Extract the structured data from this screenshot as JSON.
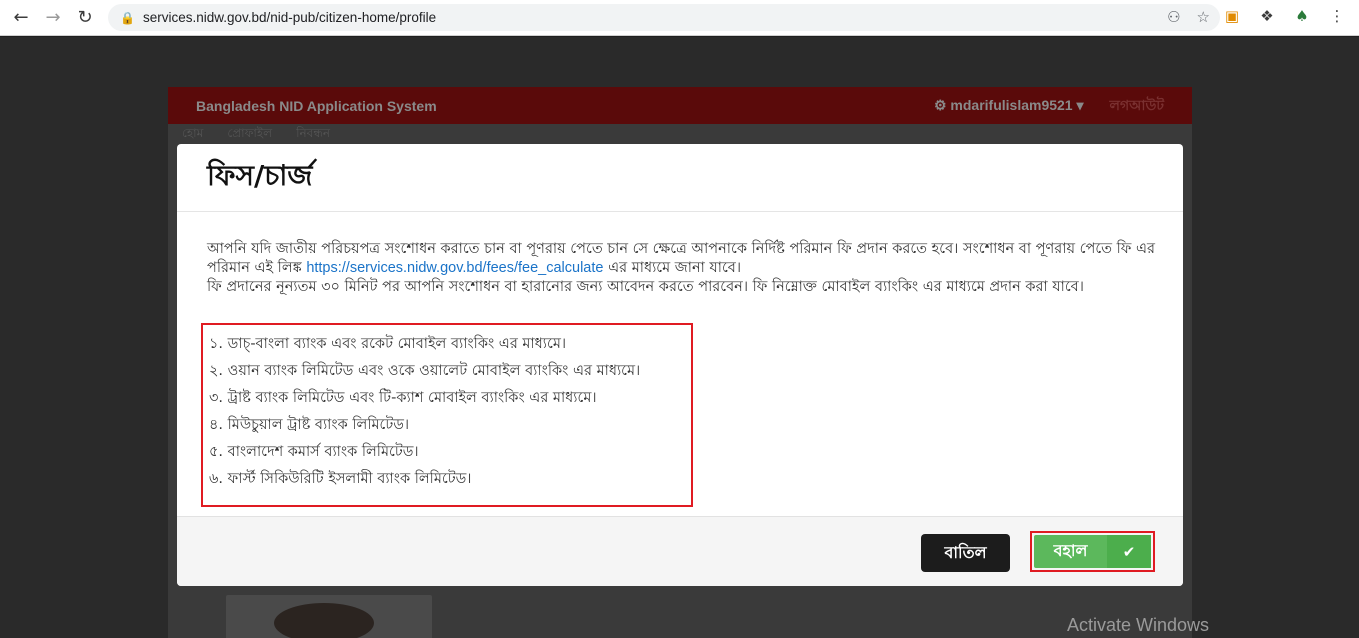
{
  "browser": {
    "url": "services.nidw.gov.bd/nid-pub/citizen-home/profile"
  },
  "app": {
    "title": "Bangladesh NID Application System",
    "username": "mdarifulislam9521",
    "logout": "লগআউট",
    "tabs": [
      "হোম",
      "প্রোফাইল",
      "নিবন্ধন"
    ]
  },
  "modal": {
    "title": "ফিস/চার্জ",
    "para1_part1": "আপনি যদি জাতীয় পরিচয়পত্র সংশোধন করাতে চান বা পূণরায় পেতে চান সে ক্ষেত্রে আপনাকে নির্দিষ্ট পরিমান ফি প্রদান করতে হবে। সংশোধন বা পূণরায় পেতে ফি এর পরিমান এই লিঙ্ক ",
    "link": "https://services.nidw.gov.bd/fees/fee_calculate",
    "para1_part2": " এর মাধ্যমে জানা যাবে।",
    "para2": "ফি প্রদানের নূন্যতম ৩০ মিনিট পর আপনি সংশোধন বা হারানোর জন্য আবেদন করতে পারবেন। ফি নিম্নোক্ত মোবাইল ব্যাংকিং এর মাধ্যমে প্রদান করা যাবে।",
    "banks": [
      "১. ডাচ্-বাংলা ব্যাংক এবং রকেট মোবাইল ব্যাংকিং এর মাধ্যমে।",
      "২. ওয়ান ব্যাংক লিমিটেড এবং ওকে ওয়ালেট মোবাইল ব্যাংকিং এর মাধ্যমে।",
      "৩. ট্রাষ্ট ব্যাংক লিমিটেড এবং টি-ক্যাশ মোবাইল ব্যাংকিং এর মাধ্যমে।",
      "৪. মিউচুয়াল ট্রাষ্ট ব্যাংক লিমিটেড।",
      "৫. বাংলাদেশ কমার্স ব্যাংক লিমিটেড।",
      "৬. ফার্স্ট সিকিউরিটি ইসলামী ব্যাংক লিমিটেড।"
    ],
    "cancel_label": "বাতিল",
    "ok_label": "বহাল"
  },
  "watermark": "Activate Windows"
}
